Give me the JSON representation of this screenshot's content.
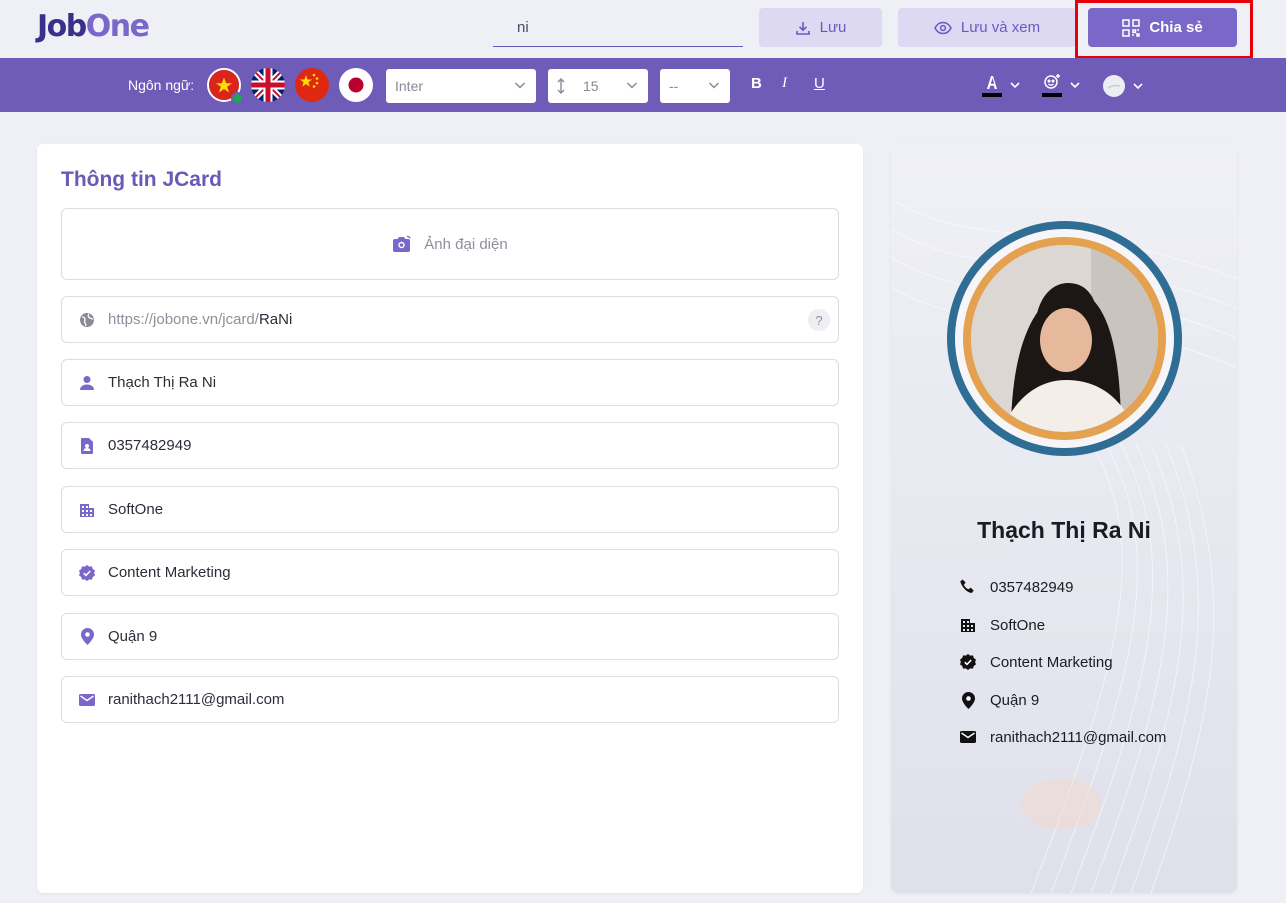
{
  "header": {
    "logo": {
      "part1": "Job",
      "part2": "One"
    },
    "doc_name": "ni",
    "save_label": "Lưu",
    "preview_label": "Lưu và xem",
    "share_label": "Chia sẻ"
  },
  "toolbar": {
    "language_label": "Ngôn ngữ:",
    "languages": [
      "vi",
      "en",
      "zh",
      "ja"
    ],
    "font": "Inter",
    "font_size": "15",
    "line_height": "--",
    "bold": "B",
    "italic": "I",
    "underline": "U",
    "text_color": "#000000",
    "highlight_color": "#000000"
  },
  "form": {
    "title": "Thông tin JCard",
    "avatar_label": "Ảnh đại diện",
    "url_prefix": "https://jobone.vn/jcard/",
    "url_slug": "RaNi",
    "help": "?",
    "name": "Thạch Thị Ra Ni",
    "phone": "0357482949",
    "company": "SoftOne",
    "position": "Content Marketing",
    "address": "Quận 9",
    "email": "ranithach2111@gmail.com"
  },
  "preview": {
    "name": "Thạch Thị Ra Ni",
    "phone": "0357482949",
    "company": "SoftOne",
    "position": "Content Marketing",
    "address": "Quận 9",
    "email": "ranithach2111@gmail.com",
    "ring_colors": [
      "#2f6d95",
      "#e4a14f"
    ]
  },
  "colors": {
    "accent": "#6f5bb8",
    "share_highlight": "#e8000b"
  }
}
